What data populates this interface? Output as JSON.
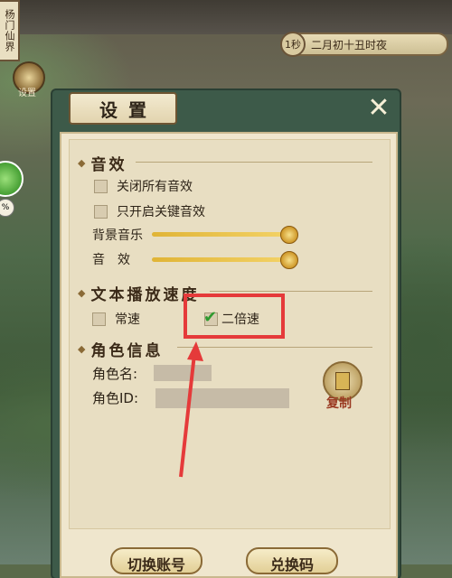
{
  "hud": {
    "left_scroll_text": "杨门仙界",
    "time_seconds": "1秒",
    "time_text": "二月初十丑时夜",
    "corner_label": "设置",
    "small_badge": "%"
  },
  "dialog": {
    "title": "设置",
    "close_label": "✕"
  },
  "sound": {
    "heading": "音效",
    "options": [
      {
        "label": "关闭所有音效",
        "checked": false
      },
      {
        "label": "只开启关键音效",
        "checked": false
      }
    ],
    "sliders": [
      {
        "label": "背景音乐",
        "level": 1.0
      },
      {
        "label": "音　效",
        "level": 1.0
      }
    ]
  },
  "playback": {
    "heading": "文本播放速度",
    "options": [
      {
        "label": "常速",
        "checked": false
      },
      {
        "label": "二倍速",
        "checked": true
      }
    ]
  },
  "role": {
    "heading": "角色信息",
    "name_label": "角色名:",
    "id_label": "角色ID:",
    "copy_label": "复制"
  },
  "footer": {
    "switch_account": "切换账号",
    "redeem_code": "兑换码"
  },
  "colors": {
    "highlight": "#e53a3a",
    "panel_frame": "#3d5a49",
    "check": "#2e9a2e"
  }
}
